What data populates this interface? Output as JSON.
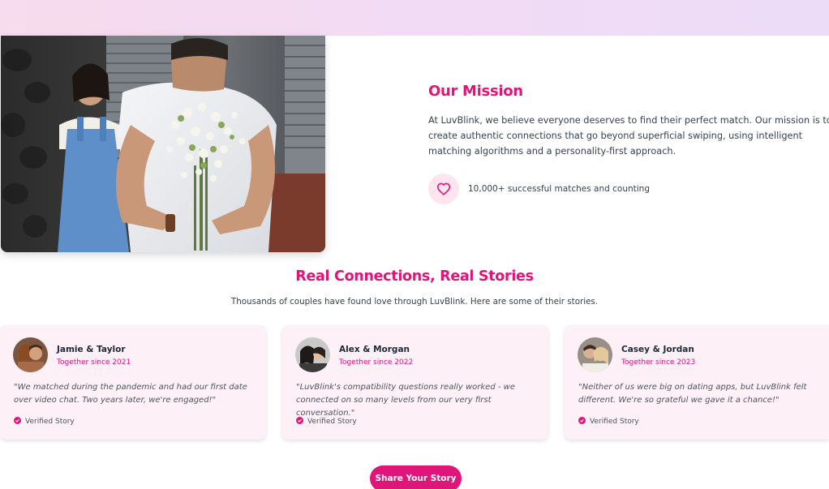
{
  "mission": {
    "title": "Our Mission",
    "text": "At LuvBlink, we believe everyone deserves to find their perfect match. Our mission is to create authentic connections that go beyond superficial swiping, using intelligent matching algorithms and a personality-first approach.",
    "stat": "10,000+ successful matches and counting",
    "stat_icon": "heart-icon"
  },
  "stories": {
    "title": "Real Connections, Real Stories",
    "subtitle": "Thousands of couples have found love through LuvBlink. Here are some of their stories.",
    "cards": [
      {
        "names": "Jamie & Taylor",
        "since": "Together since 2021",
        "quote": "\"We matched during the pandemic and had our first date over video chat. Two years later, we're engaged!\"",
        "verified": "Verified Story"
      },
      {
        "names": "Alex & Morgan",
        "since": "Together since 2022",
        "quote": "\"LuvBlink's compatibility questions really worked - we connected on so many levels from our very first conversation.\"",
        "verified": "Verified Story"
      },
      {
        "names": "Casey & Jordan",
        "since": "Together since 2023",
        "quote": "\"Neither of us were big on dating apps, but LuvBlink felt different. We're so grateful we gave it a chance!\"",
        "verified": "Verified Story"
      }
    ],
    "cta": "Share Your Story"
  },
  "colors": {
    "accent": "#e0157a",
    "card_bg": "#fdf0f6",
    "heart_bg": "#fde4ef"
  }
}
